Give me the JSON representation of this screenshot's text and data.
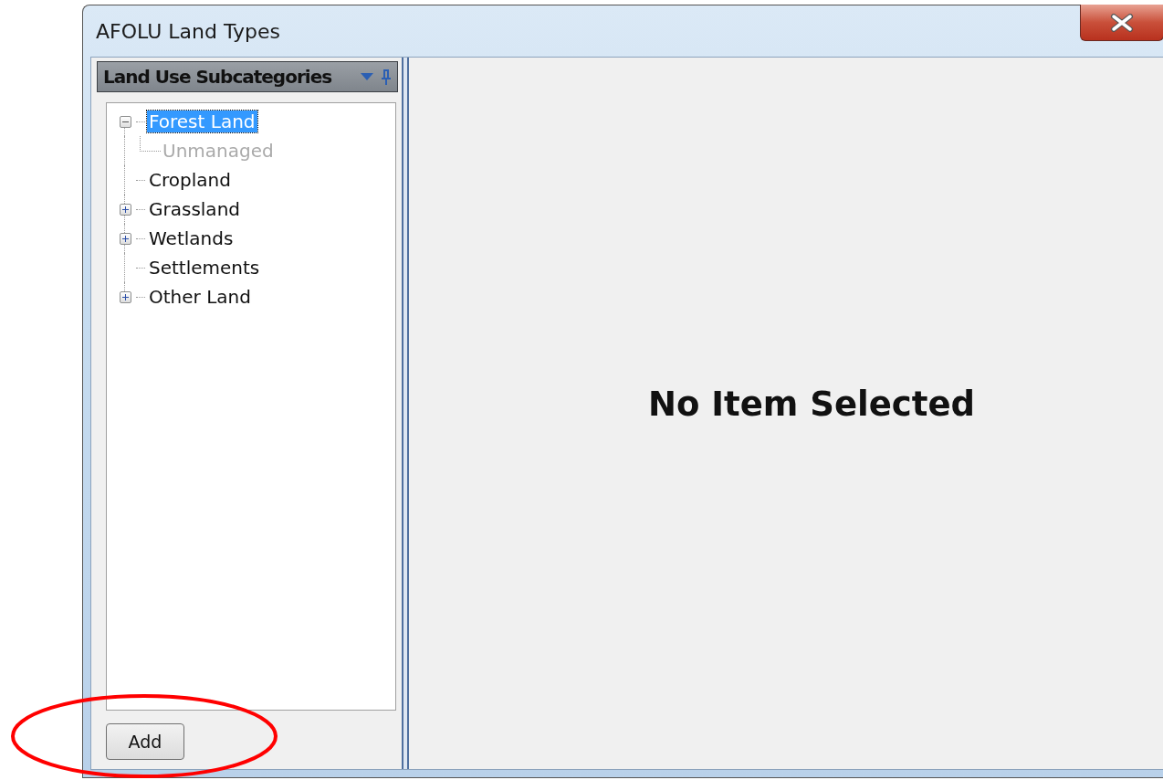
{
  "window": {
    "title": "AFOLU Land Types"
  },
  "panel": {
    "title": "Land Use Subcategories"
  },
  "tree": [
    {
      "label": "Forest Land",
      "kind": "group",
      "expanded": true,
      "selected": true,
      "disabled": false,
      "children": [
        {
          "label": "Unmanaged",
          "selected": false,
          "disabled": true
        }
      ]
    },
    {
      "label": "Cropland",
      "kind": "leaf",
      "selected": false,
      "disabled": false
    },
    {
      "label": "Grassland",
      "kind": "group",
      "expanded": false,
      "selected": false,
      "disabled": false
    },
    {
      "label": "Wetlands",
      "kind": "group",
      "expanded": false,
      "selected": false,
      "disabled": false
    },
    {
      "label": "Settlements",
      "kind": "leaf",
      "selected": false,
      "disabled": false
    },
    {
      "label": "Other Land",
      "kind": "group",
      "expanded": false,
      "selected": false,
      "disabled": false
    }
  ],
  "add_button": "Add",
  "detail": {
    "message": "No Item Selected"
  },
  "annotation": {
    "kind": "ellipse",
    "color": "#ff0000"
  }
}
